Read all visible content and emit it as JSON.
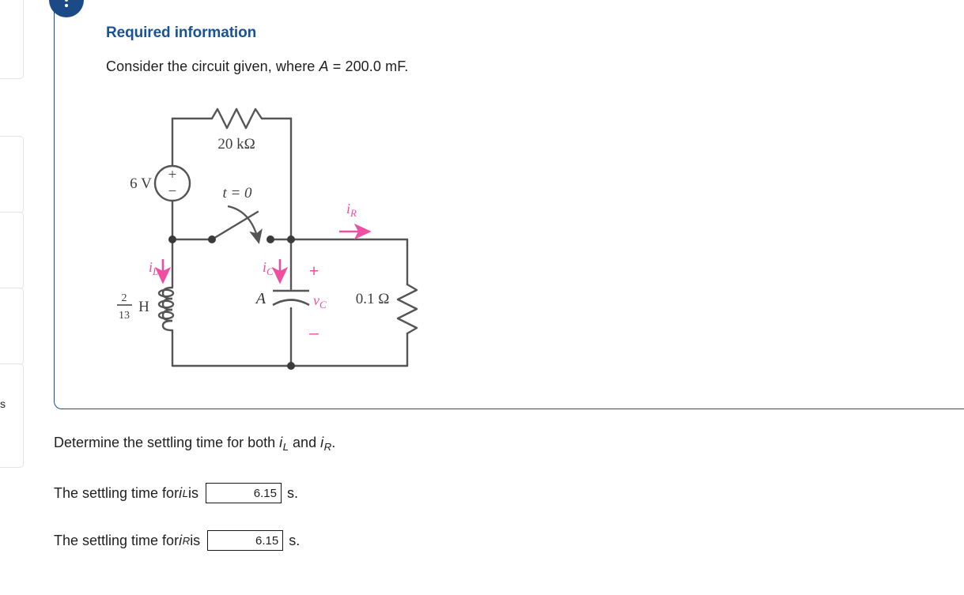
{
  "edge": {
    "clipped_text": "s"
  },
  "badge": {
    "icon": "vertical-ellipsis-icon"
  },
  "panel": {
    "heading": "Required information",
    "prompt_prefix": "Consider the circuit given, where ",
    "prompt_var": "A",
    "prompt_suffix": " = 200.0 mF.",
    "heading_color": "#1a5296",
    "border_color": "#1c4f8e"
  },
  "circuit": {
    "title": "RLC switching circuit",
    "source_label": "6 V",
    "source_plus": "+",
    "source_minus": "−",
    "top_resistor_label": "20 kΩ",
    "switch_label": "t = 0",
    "inductor_numerator": "2",
    "inductor_denominator": "13",
    "inductor_unit": "H",
    "capacitor_label": "A",
    "capacitor_voltage_label": "v",
    "capacitor_voltage_sub": "C",
    "capacitor_plus": "+",
    "capacitor_minus": "–",
    "right_resistor_label": "0.1 Ω",
    "current_il": "i",
    "current_il_sub": "L",
    "current_ic": "i",
    "current_ic_sub": "C",
    "current_ir": "i",
    "current_ir_sub": "R",
    "wire_color": "#555555",
    "annotation_color": "#ef4fa0"
  },
  "question": {
    "text_prefix": "Determine the settling time for both ",
    "var_1": "i",
    "var_1_sub": "L",
    "text_middle": " and ",
    "var_2": "i",
    "var_2_sub": "R",
    "text_suffix": "."
  },
  "answers": [
    {
      "label_prefix": "The settling time for ",
      "var": "i",
      "var_sub": "L",
      "label_suffix": " is",
      "value": "6.15",
      "placeholder": "",
      "unit": "s."
    },
    {
      "label_prefix": "The settling time for ",
      "var": "i",
      "var_sub": "R",
      "label_suffix": " is",
      "value": "6.15",
      "placeholder": "",
      "unit": "s."
    }
  ]
}
